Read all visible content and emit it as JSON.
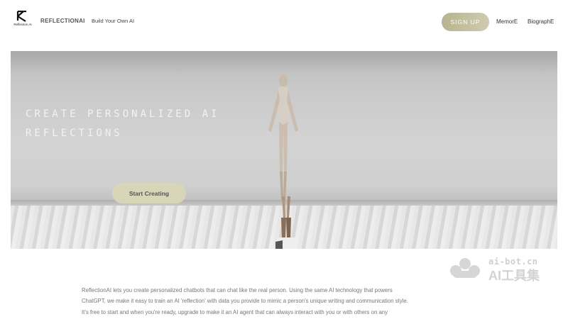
{
  "header": {
    "logo_text": "Reflection AI",
    "brand": "REFLECTIONAI",
    "tagline": "Build Your Own AI",
    "signup_label": "SIGN UP",
    "nav": [
      "MemorE",
      "BiographE"
    ]
  },
  "hero": {
    "title_line1": "CREATE PERSONALIZED AI",
    "title_line2": "REFLECTIONS",
    "cta_label": "Start Creating"
  },
  "watermark": {
    "url": "ai-bot.cn",
    "name": "AI工具集"
  },
  "description": {
    "lines": [
      "ReflectionAI lets you create personalized chatbots that can chat like the real person.  Using the same AI technology that powers",
      "ChatGPT, we make it easy to train an AI 'reflection' with data you provide to mimic a person's unique writing and communication style.",
      "It's free to start and when you're ready, upgrade to make it an AI agent that can always interact with you or with others on any"
    ]
  },
  "colors": {
    "accent": "#c4bf9f",
    "cta_bg": "#d9d6b8"
  },
  "icons": {
    "logo": "reflection-logo-icon",
    "watermark": "cloud-icon"
  }
}
